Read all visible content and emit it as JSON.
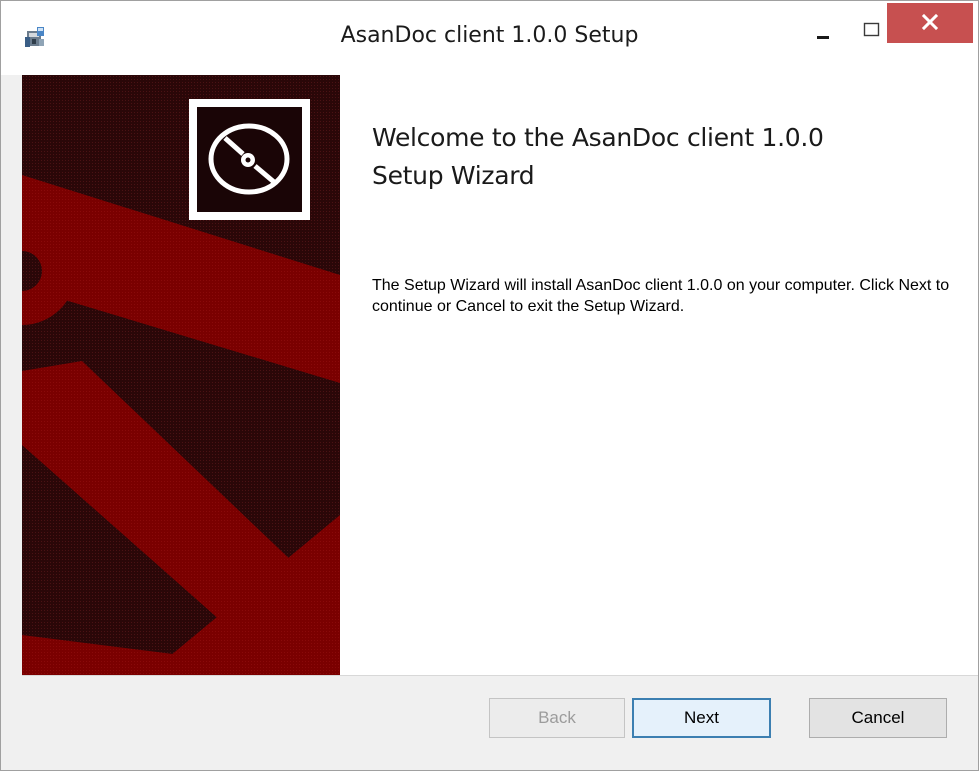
{
  "window": {
    "title": "AsanDoc client 1.0.0 Setup",
    "icon": "installer-icon",
    "controls": {
      "minimize_icon": "minimize-icon",
      "maximize_icon": "maximize-icon",
      "close_icon": "close-icon",
      "close_color": "#c75050"
    }
  },
  "banner": {
    "background_color": "#2a0708",
    "anchor_color": "#7a0000",
    "logo_icon": "disc-icon"
  },
  "main": {
    "heading_line1": "Welcome to the AsanDoc client 1.0.0",
    "heading_line2": "Setup Wizard",
    "description": "The Setup Wizard will install AsanDoc client 1.0.0 on your computer. Click Next to continue or Cancel to exit the Setup Wizard."
  },
  "footer": {
    "back_label": "Back",
    "next_label": "Next",
    "cancel_label": "Cancel"
  }
}
